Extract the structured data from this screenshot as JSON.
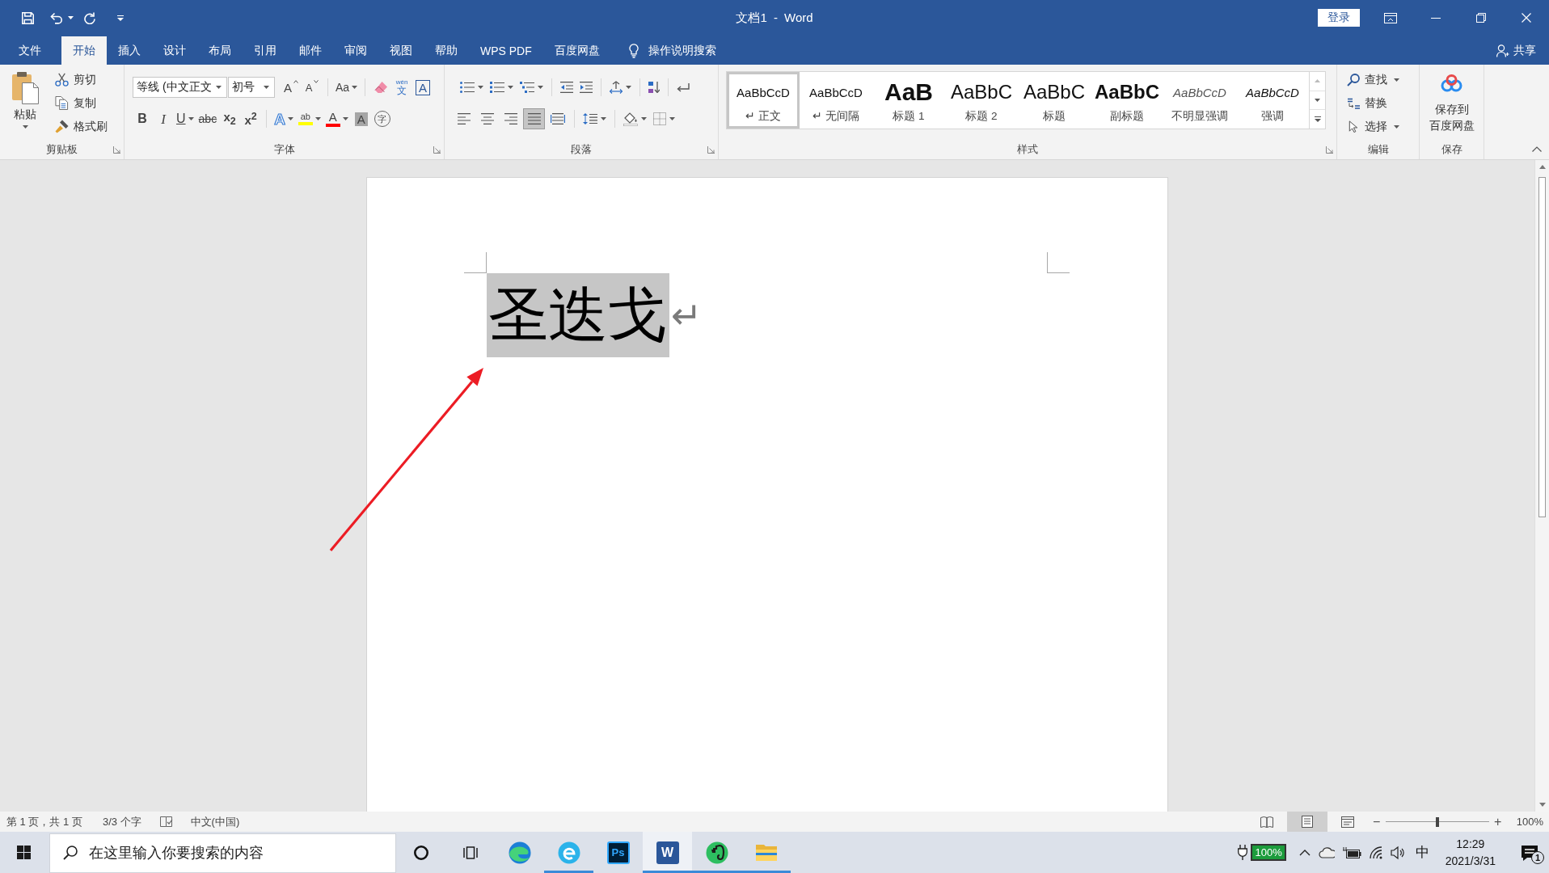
{
  "window": {
    "title": "文档1 - Word",
    "login_button": "登录"
  },
  "ribbon_tabs": [
    {
      "label": "文件",
      "selected": false
    },
    {
      "label": "开始",
      "selected": true
    },
    {
      "label": "插入",
      "selected": false
    },
    {
      "label": "设计",
      "selected": false
    },
    {
      "label": "布局",
      "selected": false
    },
    {
      "label": "引用",
      "selected": false
    },
    {
      "label": "邮件",
      "selected": false
    },
    {
      "label": "审阅",
      "selected": false
    },
    {
      "label": "视图",
      "selected": false
    },
    {
      "label": "帮助",
      "selected": false
    },
    {
      "label": "WPS PDF",
      "selected": false
    },
    {
      "label": "百度网盘",
      "selected": false
    }
  ],
  "tell_me": "操作说明搜索",
  "share": "共享",
  "clipboard": {
    "paste": "粘贴",
    "commands": [
      {
        "kind": "cut",
        "label": "剪切"
      },
      {
        "kind": "copy",
        "label": "复制"
      },
      {
        "kind": "painter",
        "label": "格式刷"
      }
    ],
    "group_label": "剪贴板"
  },
  "font": {
    "font_name": "等线 (中文正文",
    "font_size": "初号",
    "row_1": [
      {
        "kind": "grow",
        "glyph": "A"
      },
      {
        "kind": "shrink",
        "glyph": "A"
      },
      {
        "kind": "case",
        "glyph": "Aa"
      },
      {
        "kind": "clear"
      },
      {
        "kind": "pinyin",
        "ruby": "wén",
        "glyph": "文"
      },
      {
        "kind": "border",
        "glyph": "A"
      }
    ],
    "row_2": [
      {
        "kind": "bold",
        "glyph": "B"
      },
      {
        "kind": "italic",
        "glyph": "I"
      },
      {
        "kind": "underline",
        "glyph": "U"
      },
      {
        "kind": "strike",
        "glyph": "abc"
      },
      {
        "kind": "subscript",
        "glyph": "x$_{2}$"
      },
      {
        "kind": "superscript",
        "glyph": "x$^{2}$"
      },
      {
        "kind": "effects",
        "glyph": "A"
      },
      {
        "kind": "highlight",
        "glyph": "ab",
        "color": "#ffff00"
      },
      {
        "kind": "font_color",
        "glyph": "A",
        "color": "#ff0000"
      },
      {
        "kind": "shading",
        "glyph": "A"
      },
      {
        "kind": "enclose",
        "glyph": "字"
      }
    ],
    "group_label": "字体"
  },
  "paragraph": {
    "alignment": [
      {
        "kind": "left",
        "selected": false
      },
      {
        "kind": "center",
        "selected": false
      },
      {
        "kind": "right",
        "selected": false
      },
      {
        "kind": "justify",
        "selected": true
      },
      {
        "kind": "distributed",
        "selected": false
      }
    ],
    "group_label": "段落"
  },
  "styles": {
    "gallery": [
      {
        "kind": "normal",
        "preview": "AaBbCcD",
        "label": "↵ 正文",
        "selected": true
      },
      {
        "kind": "normal",
        "preview": "AaBbCcD",
        "label": "↵ 无间隔",
        "selected": false
      },
      {
        "kind": "heading1",
        "preview": "AaB",
        "label": "标题 1",
        "selected": false
      },
      {
        "kind": "heading2",
        "preview": "AaBbC",
        "label": "标题 2",
        "selected": false
      },
      {
        "kind": "title",
        "preview": "AaBbC",
        "label": "标题",
        "selected": false
      },
      {
        "kind": "subtitle",
        "preview": "AaBbC",
        "label": "副标题",
        "selected": false
      },
      {
        "kind": "subtle",
        "preview": "AaBbCcD",
        "label": "不明显强调",
        "selected": false
      },
      {
        "kind": "emphasis",
        "preview": "AaBbCcD",
        "label": "强调",
        "selected": false
      }
    ],
    "group_label": "样式"
  },
  "editing": {
    "commands": [
      {
        "kind": "find",
        "label": "查找",
        "caret": true
      },
      {
        "kind": "replace",
        "label": "替换",
        "caret": false
      },
      {
        "kind": "select",
        "label": "选择",
        "caret": true
      }
    ],
    "group_label": "编辑"
  },
  "save": {
    "label_lines": [
      "保存到",
      "百度网盘"
    ],
    "group_label": "保存"
  },
  "document": {
    "text": "圣迭戈",
    "selected": true,
    "paragraph_mark": "↵"
  },
  "status_bar": {
    "page": "第 1 页，共 1 页",
    "words": "3/3 个字",
    "language": "中文(中国)",
    "views": [
      {
        "kind": "read",
        "selected": false
      },
      {
        "kind": "print",
        "selected": true
      },
      {
        "kind": "web",
        "selected": false
      }
    ],
    "zoom_out": "−",
    "zoom": {
      "level": 0.5
    },
    "zoom_in": "+",
    "zoom_reading": "100%"
  },
  "taskbar": {
    "search": {
      "placeholder": "在这里输入你要搜索的内容"
    },
    "apps": [
      {
        "kind": "cortana",
        "running": false,
        "selected": false
      },
      {
        "kind": "taskview",
        "running": false,
        "selected": false
      },
      {
        "kind": "edge",
        "running": false,
        "selected": false
      },
      {
        "kind": "ebrowser",
        "running": true,
        "selected": false
      },
      {
        "kind": "photoshop",
        "glyph": "Ps",
        "running": false,
        "selected": false
      },
      {
        "kind": "word",
        "glyph": "W",
        "running": true,
        "selected": true
      },
      {
        "kind": "evernote",
        "running": true,
        "selected": false
      },
      {
        "kind": "explorer",
        "running": true,
        "selected": false
      }
    ],
    "battery": "100%",
    "ime": "中",
    "time": "12:29",
    "date": "2021/3/31",
    "notifications": "1"
  }
}
